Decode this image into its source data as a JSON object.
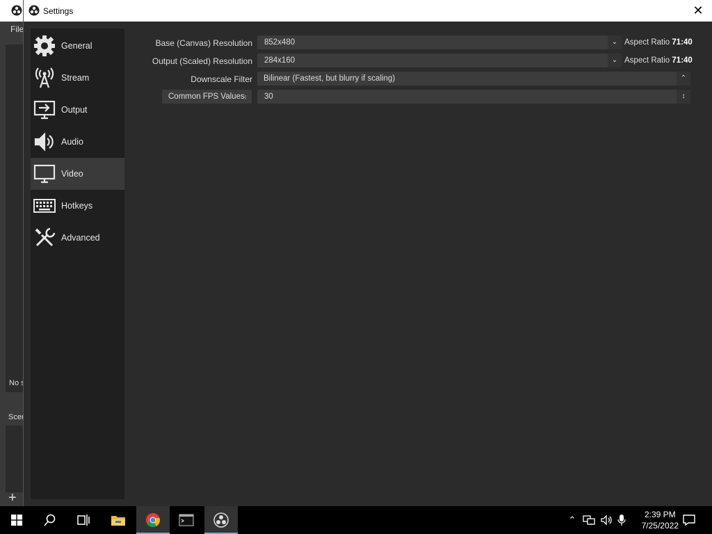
{
  "background_window": {
    "menu_file": "File",
    "no_source": "No s",
    "scenes": "Scer",
    "add": "+"
  },
  "dialog": {
    "title": "Settings",
    "close": "✕"
  },
  "sidebar": {
    "items": [
      {
        "label": "General",
        "icon": "gear-icon"
      },
      {
        "label": "Stream",
        "icon": "broadcast-antenna-icon"
      },
      {
        "label": "Output",
        "icon": "output-monitor-icon"
      },
      {
        "label": "Audio",
        "icon": "speaker-icon"
      },
      {
        "label": "Video",
        "icon": "monitor-icon"
      },
      {
        "label": "Hotkeys",
        "icon": "keyboard-icon"
      },
      {
        "label": "Advanced",
        "icon": "tools-icon"
      }
    ],
    "selected": "Video"
  },
  "video": {
    "base_resolution": {
      "label": "Base (Canvas) Resolution",
      "value": "852x480",
      "aspect_prefix": "Aspect Ratio",
      "aspect_value": "71:40"
    },
    "output_resolution": {
      "label": "Output (Scaled) Resolution",
      "value": "284x160",
      "aspect_prefix": "Aspect Ratio",
      "aspect_value": "71:40"
    },
    "downscale_filter": {
      "label": "Downscale Filter",
      "value": "Bilinear (Fastest, but blurry if scaling)"
    },
    "fps": {
      "type_label": "Common FPS Values",
      "value": "30"
    }
  },
  "taskbar": {
    "time": "2:39 PM",
    "date": "7/25/2022",
    "apps": [
      "windows-start-icon",
      "search-icon",
      "task-view-icon",
      "file-explorer-icon",
      "chrome-icon",
      "terminal-icon",
      "obs-icon"
    ]
  }
}
